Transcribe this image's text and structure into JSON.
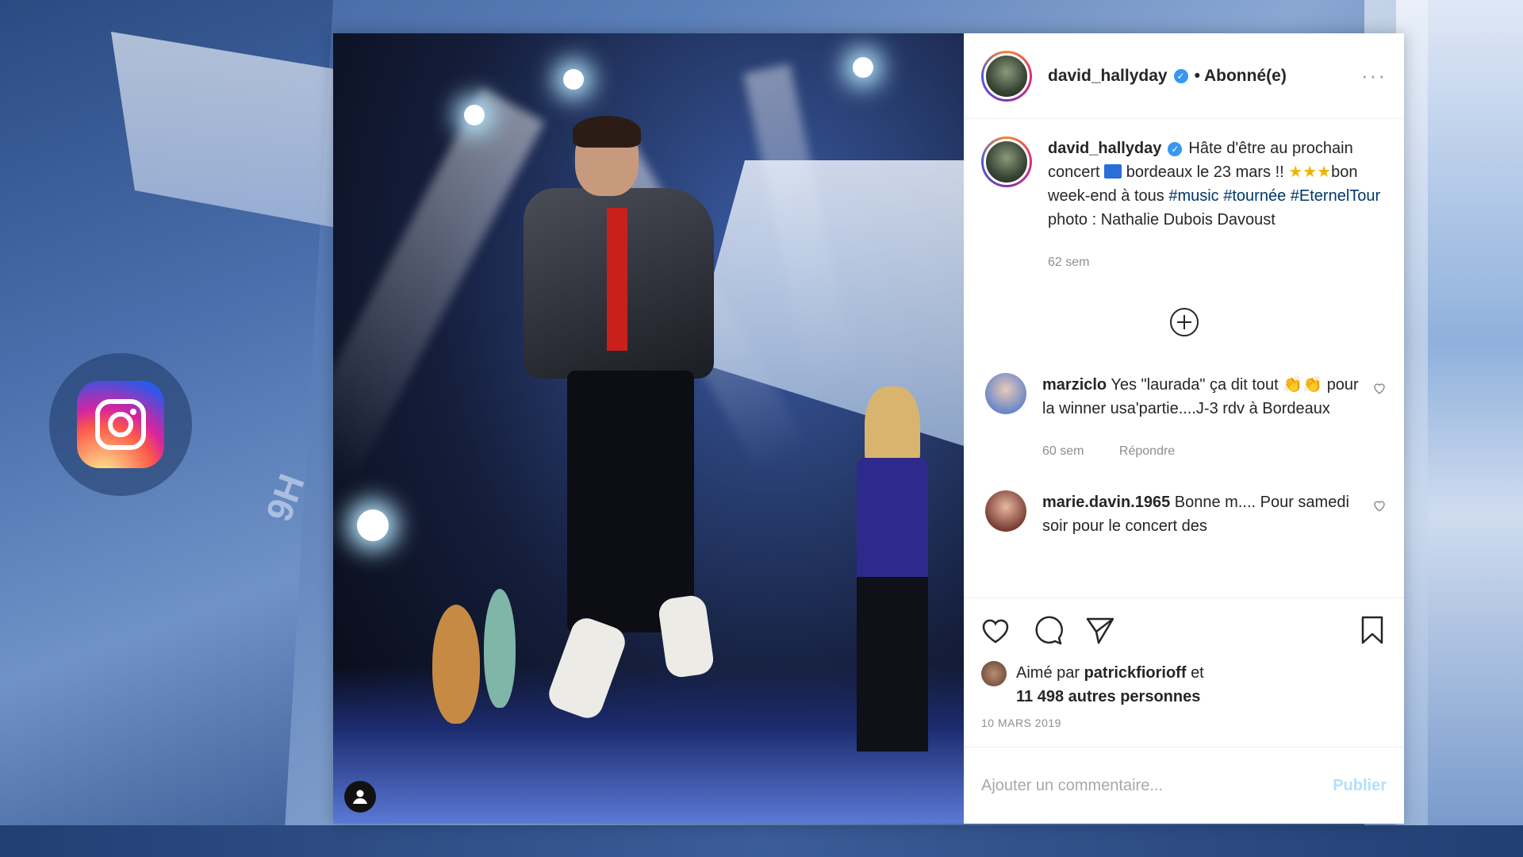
{
  "background": {
    "watermark": "9H"
  },
  "post": {
    "author": {
      "username": "david_hallyday",
      "follow_status": "• Abonné(e)",
      "more": "···"
    },
    "caption": {
      "username": "david_hallyday",
      "text_1": "Hâte d'être au prochain concert",
      "text_2": "bordeaux le 23 mars !!",
      "text_3": "bon week-end à tous",
      "hashtags": [
        "#music",
        "#tournée",
        "#EternelTour"
      ],
      "text_4": "photo : Nathalie Dubois Davoust",
      "age": "62 sem"
    },
    "comments": [
      {
        "username": "marziclo",
        "text_1": "Yes \"laurada\" ça dit tout",
        "text_2": "pour la winner usa'partie....J-3 rdv à Bordeaux",
        "age": "60 sem",
        "reply": "Répondre"
      },
      {
        "username": "marie.davin.1965",
        "text": "Bonne m.... Pour samedi soir pour le concert des"
      }
    ],
    "likes": {
      "prefix": "Aimé par",
      "user": "patrickfiorioff",
      "conj": "et",
      "others": "11 498 autres personnes"
    },
    "date": "10 MARS 2019",
    "add_comment": {
      "placeholder": "Ajouter un commentaire...",
      "publish": "Publier"
    }
  }
}
